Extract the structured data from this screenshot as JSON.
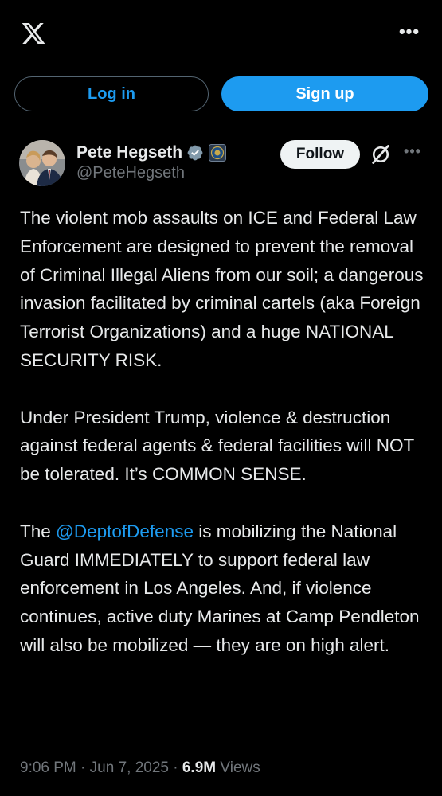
{
  "top_bar": {
    "logo_icon": "x-logo-icon",
    "more_icon": "more-horizontal-icon",
    "more_glyph": "•••"
  },
  "auth": {
    "login_label": "Log in",
    "signup_label": "Sign up"
  },
  "post": {
    "author": {
      "display_name": "Pete Hegseth",
      "handle": "@PeteHegseth",
      "verified_icon": "verified-badge-icon",
      "affiliation_icon": "dod-seal-icon"
    },
    "follow_label": "Follow",
    "grok_icon": "grok-icon",
    "more_glyph": "•••",
    "paragraph_1": "The violent mob assaults on ICE and Federal Law Enforcement are designed to prevent the removal of Criminal Illegal Aliens from our soil; a dangerous invasion facilitated by criminal cartels (aka Foreign Terrorist Organizations) and a huge NATIONAL SECURITY RISK.",
    "paragraph_2": "Under President Trump, violence & destruction against federal agents & federal facilities will NOT be tolerated. It’s COMMON SENSE.",
    "paragraph_3": {
      "before": "The ",
      "mention": "@DeptofDefense",
      "after": " is mobilizing the National Guard IMMEDIATELY to support federal law enforcement in Los Angeles. And, if violence continues, active duty Marines at Camp Pendleton will also be mobilized — they are on high alert."
    },
    "meta": {
      "time": "9:06 PM",
      "date": "Jun 7, 2025",
      "separator": " · ",
      "views_count": "6.9M",
      "views_label": "Views"
    }
  },
  "colors": {
    "background": "#000000",
    "text": "#e7e9ea",
    "muted": "#71767b",
    "accent": "#1d9bf0",
    "follow_bg": "#eff3f4"
  }
}
